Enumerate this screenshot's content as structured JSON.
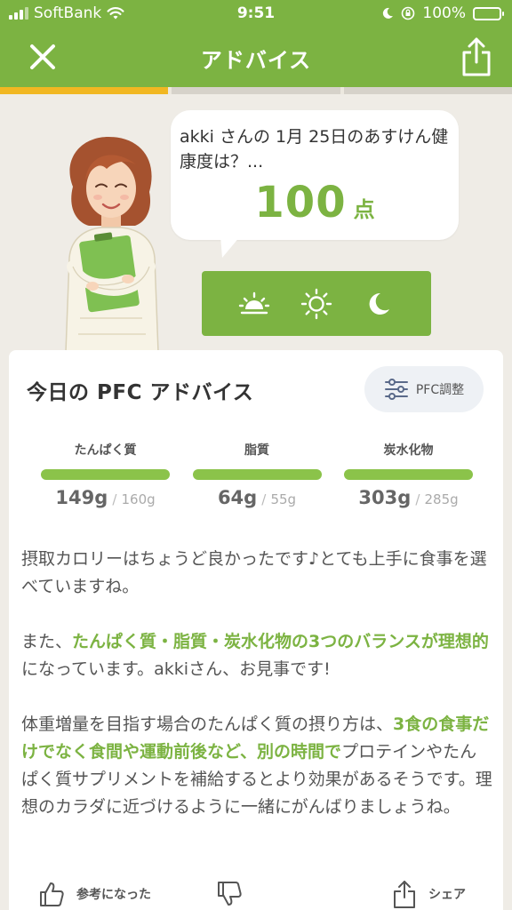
{
  "status_bar": {
    "carrier": "SoftBank",
    "time": "9:51",
    "battery_percent": "100%"
  },
  "header": {
    "title": "アドバイス"
  },
  "progress": {
    "segments": 3,
    "active_index": 0,
    "active_color": "#f1b722"
  },
  "bubble": {
    "question": "akki さんの 1月 25日のあすけん健康度は？...",
    "score": "100",
    "score_unit": "点"
  },
  "time_of_day": {
    "options": [
      "morning",
      "noon",
      "night"
    ]
  },
  "pfc_card": {
    "title": "今日の PFC アドバイス",
    "adjust_button": "PFC調整",
    "macros": [
      {
        "label": "たんぱく質",
        "actual": "149g",
        "separator": "/",
        "target": "160g"
      },
      {
        "label": "脂質",
        "actual": "64g",
        "separator": "/",
        "target": "55g"
      },
      {
        "label": "炭水化物",
        "actual": "303g",
        "separator": "/",
        "target": "285g"
      }
    ]
  },
  "advice": {
    "p1": "摂取カロリーはちょうど良かったです♪とても上手に食事を選べていますね。",
    "p2_a": "また、",
    "p2_hl": "たんぱく質・脂質・炭水化物の3つのバランスが理想的",
    "p2_b": "になっています。akkiさん、お見事です!",
    "p3_a": "体重増量を目指す場合のたんぱく質の摂り方は、",
    "p3_hl1": "3食の食事だけでなく食間や運動前後など、別の時間で",
    "p3_b": "プロテインやたんぱく質サプリメントを補給するとより効果があるそうです。理想のカラダに近づけるように一緒にがんばりましょうね。"
  },
  "actions": {
    "helpful": "参考になった",
    "share": "シェア"
  },
  "colors": {
    "brand_green": "#7cb342",
    "accent_yellow": "#f1b722",
    "background": "#efece6"
  }
}
